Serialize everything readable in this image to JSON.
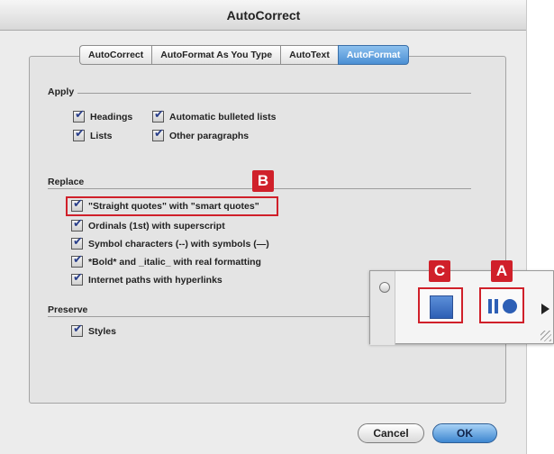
{
  "window": {
    "title": "AutoCorrect"
  },
  "tabs": [
    {
      "label": "AutoCorrect",
      "active": false
    },
    {
      "label": "AutoFormat As You Type",
      "active": false
    },
    {
      "label": "AutoText",
      "active": false
    },
    {
      "label": "AutoFormat",
      "active": true
    }
  ],
  "apply": {
    "label": "Apply",
    "options": [
      {
        "label": "Headings",
        "checked": true
      },
      {
        "label": "Automatic bulleted lists",
        "checked": true
      },
      {
        "label": "Lists",
        "checked": true
      },
      {
        "label": "Other paragraphs",
        "checked": true
      }
    ]
  },
  "replace": {
    "label": "Replace",
    "options": [
      {
        "label": "\"Straight quotes\" with \"smart quotes\"",
        "checked": true
      },
      {
        "label": "Ordinals (1st) with superscript",
        "checked": true
      },
      {
        "label": "Symbol characters (--) with symbols (—)",
        "checked": true
      },
      {
        "label": "*Bold* and _italic_ with real formatting",
        "checked": true
      },
      {
        "label": "Internet paths with hyperlinks",
        "checked": true
      }
    ]
  },
  "preserve": {
    "label": "Preserve",
    "options": [
      {
        "label": "Styles",
        "checked": true
      }
    ]
  },
  "callouts": {
    "a": "A",
    "b": "B",
    "c": "C"
  },
  "floating_palette": {
    "icons": [
      "square-style-icon",
      "bars-dot-icon",
      "arrow-right-icon"
    ]
  },
  "buttons": {
    "cancel": "Cancel",
    "ok": "OK"
  },
  "colors": {
    "callout": "#d0202a",
    "accent": "#3d86d0"
  }
}
